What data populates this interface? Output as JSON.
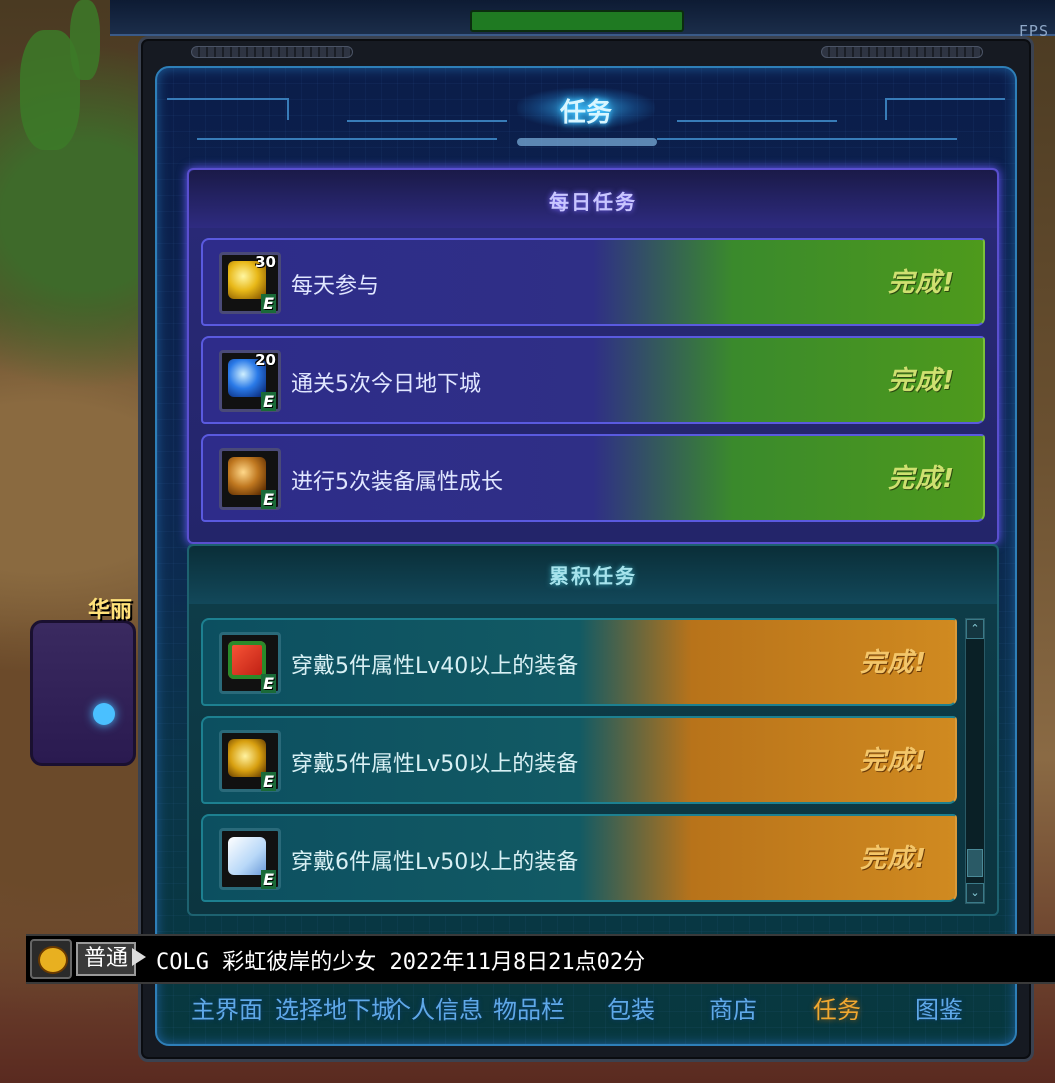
{
  "window": {
    "title": "任务",
    "fps_label": "FPS"
  },
  "scene": {
    "npc_name_fragment": "华丽"
  },
  "daily": {
    "title": "每日任务",
    "tasks": [
      {
        "label": "每天参与",
        "status": "完成!",
        "reward_count": "30",
        "reward_icon": "gold-coin-icon",
        "badge": "E"
      },
      {
        "label": "通关5次今日地下城",
        "status": "完成!",
        "reward_count": "20",
        "reward_icon": "blue-crystal-icon",
        "badge": "E"
      },
      {
        "label": "进行5次装备属性成长",
        "status": "完成!",
        "reward_count": "",
        "reward_icon": "armor-chest-icon",
        "badge": "E"
      }
    ]
  },
  "cumulative": {
    "title": "累积任务",
    "tasks": [
      {
        "label": "穿戴5件属性Lv40以上的装备",
        "status": "完成!",
        "reward_icon": "gift-box-icon",
        "badge": "E"
      },
      {
        "label": "穿戴5件属性Lv50以上的装备",
        "status": "完成!",
        "reward_icon": "gold-emblem-icon",
        "badge": "E"
      },
      {
        "label": "穿戴6件属性Lv50以上的装备",
        "status": "完成!",
        "reward_icon": "ice-crystal-icon",
        "badge": "E"
      }
    ],
    "scroll_up": "⌃",
    "scroll_down": "⌄"
  },
  "chat": {
    "channel": "普通",
    "message": "COLG 彩虹彼岸的少女 2022年11月8日21点02分"
  },
  "nav": {
    "items": [
      {
        "label": "主界面",
        "active": false
      },
      {
        "label": "选择地下城",
        "active": false
      },
      {
        "label": "个人信息",
        "active": false
      },
      {
        "label": "物品栏",
        "active": false
      },
      {
        "label": "包装",
        "active": false
      },
      {
        "label": "商店",
        "active": false
      },
      {
        "label": "任务",
        "active": true
      },
      {
        "label": "图鉴",
        "active": false
      }
    ]
  },
  "colors": {
    "daily_complete": "#cfe070",
    "cumulative_complete": "#f3c66a",
    "nav_active": "#f0a830",
    "nav_inactive": "#5fa8e8"
  }
}
